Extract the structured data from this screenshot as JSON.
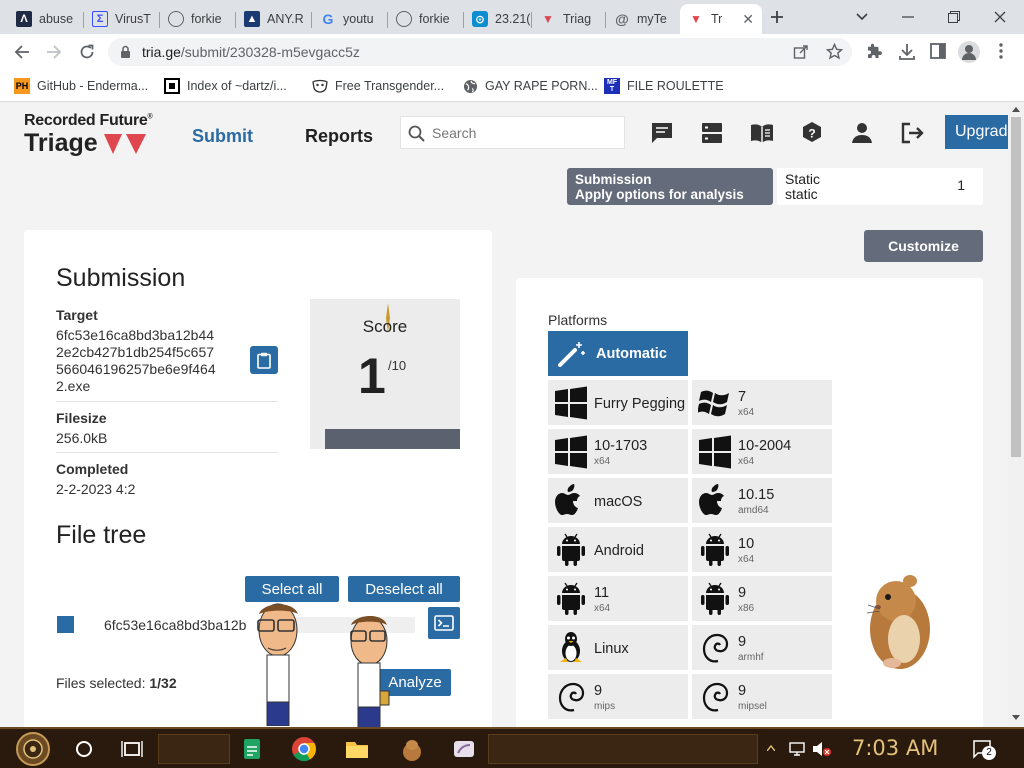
{
  "browser": {
    "tabs": [
      {
        "title": "abuse",
        "icon": "abuse-icon"
      },
      {
        "title": "VirusT",
        "icon": "virustotal-icon"
      },
      {
        "title": "forkie",
        "icon": "globe-icon"
      },
      {
        "title": "ANY.R",
        "icon": "anyrun-icon"
      },
      {
        "title": "youtu",
        "icon": "google-icon"
      },
      {
        "title": "forkie",
        "icon": "globe-icon"
      },
      {
        "title": "23.21(",
        "icon": "location-icon"
      },
      {
        "title": "Triag",
        "icon": "triage-icon"
      },
      {
        "title": "myTe",
        "icon": "at-icon"
      },
      {
        "title": "Tr",
        "icon": "triage-icon",
        "active": true
      }
    ],
    "url_host": "tria.ge",
    "url_path": "/submit/230328-m5evgacc5z",
    "bookmarks": [
      {
        "title": "GitHub - Enderma...",
        "icon": "ph-icon"
      },
      {
        "title": "Index of ~dartz/i...",
        "icon": "qr-icon"
      },
      {
        "title": "Free Transgender...",
        "icon": "mask-icon"
      },
      {
        "title": "GAY RAPE PORN...",
        "icon": "globe-icon"
      },
      {
        "title": "FILE ROULETTE",
        "icon": "mft-icon"
      }
    ]
  },
  "site": {
    "logo_top": "Recorded Future",
    "logo_reg": "®",
    "logo_main": "Triage",
    "nav_submit": "Submit",
    "nav_reports": "Reports",
    "search_placeholder": "Search",
    "upgrade": "Upgrade"
  },
  "submission_strip": {
    "label_title": "Submission",
    "label_sub": "Apply options for analysis",
    "static_title": "Static",
    "static_sub": "static",
    "static_count": "1",
    "customize": "Customize"
  },
  "submission": {
    "title": "Submission",
    "target_label": "Target",
    "target_lines": [
      "6fc53e16ca8bd3ba12b44",
      "2e2cb427b1db254f5c657",
      "566046196257be6e9f464",
      "2.exe"
    ],
    "filesize_label": "Filesize",
    "filesize": "256.0kB",
    "completed_label": "Completed",
    "completed": "2-2-2023 4:2",
    "score_label": "Score",
    "score": "1",
    "score_max": "/10",
    "file_tree_title": "File tree",
    "select_all": "Select all",
    "deselect_all": "Deselect all",
    "file_name": "6fc53e16ca8bd3ba12b",
    "files_selected_label": "Files selected:",
    "files_selected_value": "1/32",
    "analyze": "Analyze"
  },
  "platforms": {
    "title": "Platforms",
    "automatic": "Automatic",
    "items": [
      {
        "name": "Furry Pegging",
        "arch": "",
        "icon": "windows-icon"
      },
      {
        "name": "7",
        "arch": "x64",
        "icon": "windows7-icon"
      },
      {
        "name": "10-1703",
        "arch": "x64",
        "icon": "windows-icon"
      },
      {
        "name": "10-2004",
        "arch": "x64",
        "icon": "windows-icon"
      },
      {
        "name": "macOS",
        "arch": "",
        "icon": "apple-icon"
      },
      {
        "name": "10.15",
        "arch": "amd64",
        "icon": "apple-icon"
      },
      {
        "name": "Android",
        "arch": "",
        "icon": "android-icon"
      },
      {
        "name": "10",
        "arch": "x64",
        "icon": "android-icon"
      },
      {
        "name": "11",
        "arch": "x64",
        "icon": "android-icon"
      },
      {
        "name": "9",
        "arch": "x86",
        "icon": "android-icon"
      },
      {
        "name": "Linux",
        "arch": "",
        "icon": "linux-icon"
      },
      {
        "name": "9",
        "arch": "armhf",
        "icon": "debian-icon"
      },
      {
        "name": "9",
        "arch": "mips",
        "icon": "debian-icon"
      },
      {
        "name": "9",
        "arch": "mipsel",
        "icon": "debian-icon"
      }
    ]
  },
  "taskbar": {
    "time": "7:03 AM",
    "notification_count": "2"
  },
  "colors": {
    "accent": "#2b6ba4",
    "slate": "#646b7a",
    "triage_red": "#e0464e"
  }
}
